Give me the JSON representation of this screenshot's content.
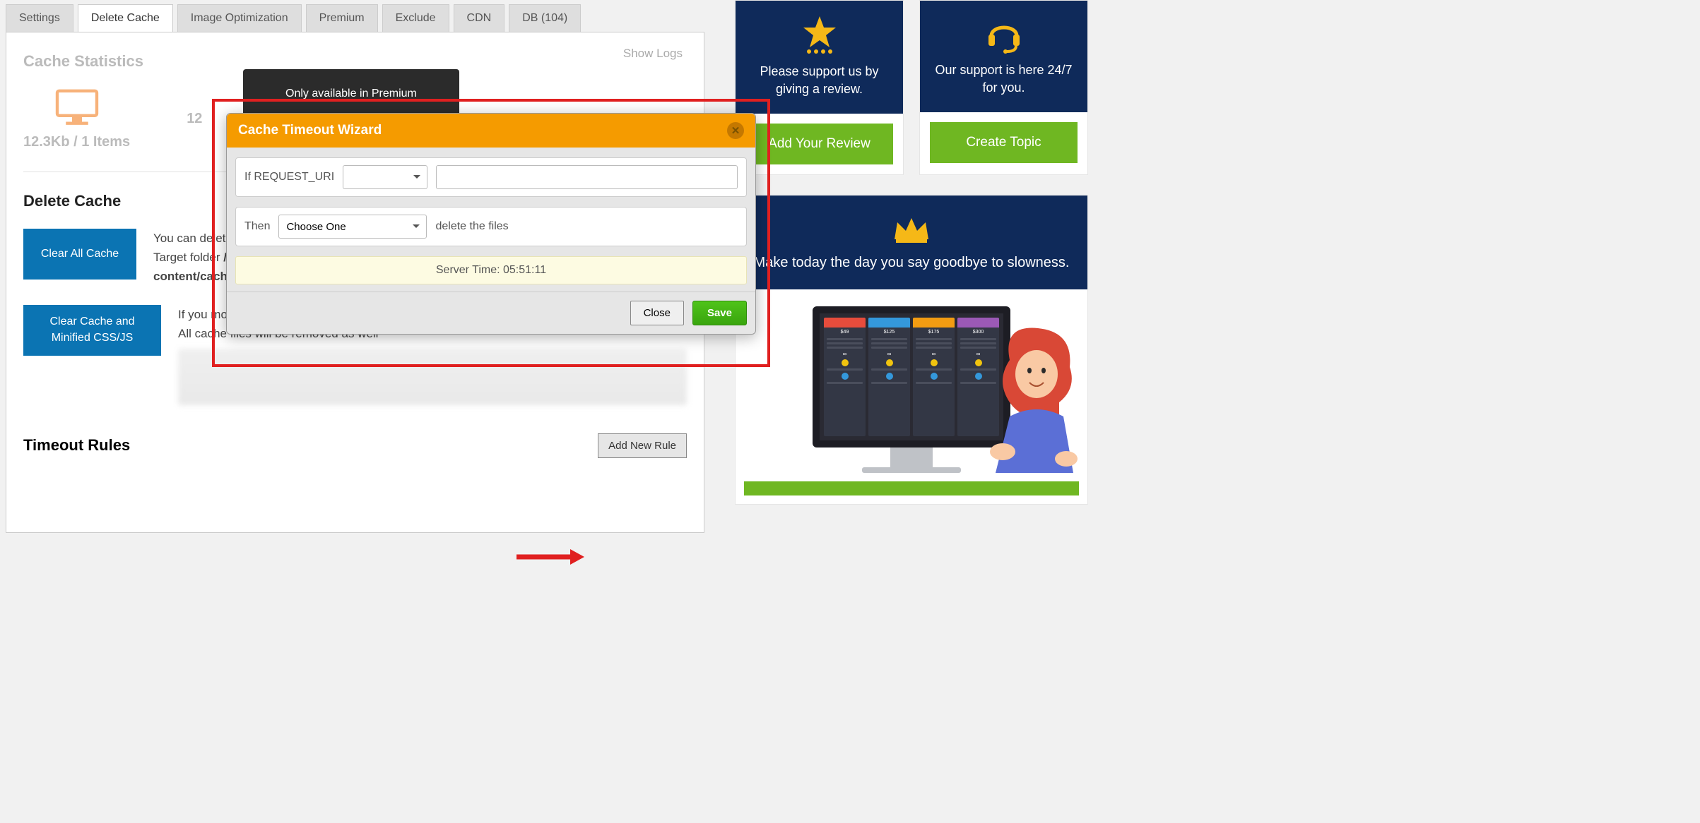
{
  "tabs": {
    "settings": "Settings",
    "delete_cache": "Delete Cache",
    "image_opt": "Image Optimization",
    "premium": "Premium",
    "exclude": "Exclude",
    "cdn": "CDN",
    "db": "DB (104)"
  },
  "panel": {
    "show_logs": "Show Logs",
    "cache_stats_title": "Cache Statistics",
    "stat1": "12.3Kb / 1 Items",
    "stat2": "12",
    "delete_cache_title": "Delete Cache",
    "clear_all_btn": "Clear All Cache",
    "clear_all_desc1": "You can delete",
    "clear_all_desc2_prefix": "Target folder ",
    "clear_all_desc2_strong": "/",
    "clear_all_desc3": "content/cache",
    "clear_minified_btn": "Clear Cache and Minified CSS/JS",
    "clear_min_desc1": "If you modify any css file, you have to delete minified css files",
    "clear_min_desc2": "All cache files will be removed as well",
    "timeout_title": "Timeout Rules",
    "add_rule_btn": "Add New Rule"
  },
  "tooltip": {
    "premium_only": "Only available in Premium"
  },
  "modal": {
    "title": "Cache Timeout Wizard",
    "if_label": "If REQUEST_URI",
    "then_label": "Then",
    "choose_one": "Choose One",
    "delete_files": "delete the files",
    "server_time": "Server Time: 05:51:11",
    "close": "Close",
    "save": "Save"
  },
  "sidebar": {
    "review_text": "Please support us by giving a review.",
    "review_btn": "Add Your Review",
    "support_text": "Our support is here 24/7 for you.",
    "support_btn": "Create Topic",
    "premium_text": "Make today the day you say goodbye to slowness.",
    "plan1_price": "$49",
    "plan2_price": "$125",
    "plan3_price": "$175",
    "plan4_price": "$300"
  }
}
